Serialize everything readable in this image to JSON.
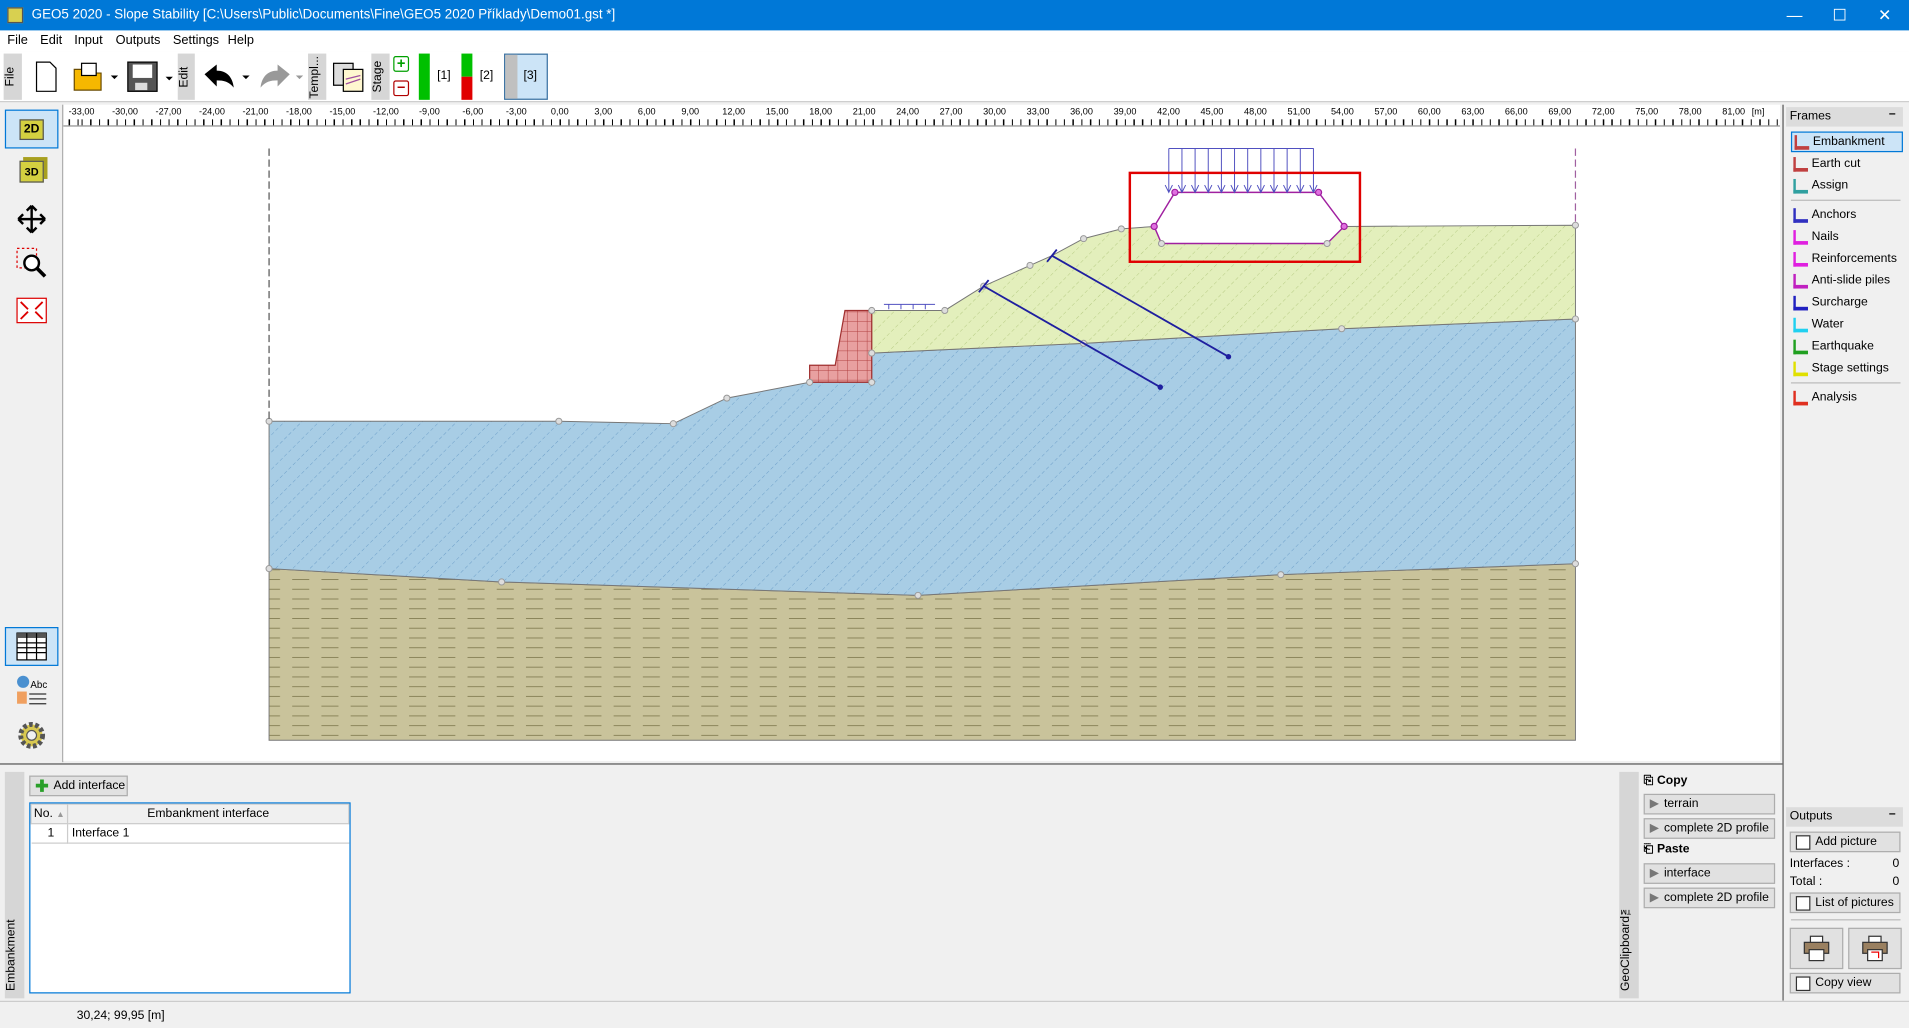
{
  "window": {
    "title": "GEO5 2020 - Slope Stability [C:\\Users\\Public\\Documents\\Fine\\GEO5 2020 Příklady\\Demo01.gst *]",
    "minimize": "—",
    "maximize": "☐",
    "close": "✕"
  },
  "menu": [
    "File",
    "Edit",
    "Input",
    "Outputs",
    "Settings",
    "Help"
  ],
  "toolbar": {
    "file_tab": "File",
    "edit_tab": "Edit",
    "templ_tab": "Templ...",
    "stage_tab": "Stage",
    "stages": [
      {
        "label": "[1]",
        "colors": [
          "#00c000"
        ]
      },
      {
        "label": "[2]",
        "colors": [
          "#00c000",
          "#e00000"
        ]
      },
      {
        "label": "[3]",
        "selected": true
      }
    ]
  },
  "ruler": {
    "labels": [
      "-33,00",
      "-30,00",
      "-27,00",
      "-24,00",
      "-21,00",
      "-18,00",
      "-15,00",
      "-12,00",
      "-9,00",
      "-6,00",
      "-3,00",
      "0,00",
      "3,00",
      "6,00",
      "9,00",
      "12,00",
      "15,00",
      "18,00",
      "21,00",
      "24,00",
      "27,00",
      "30,00",
      "33,00",
      "36,00",
      "39,00",
      "42,00",
      "45,00",
      "48,00",
      "51,00",
      "54,00",
      "57,00",
      "60,00",
      "63,00",
      "66,00",
      "69,00",
      "72,00",
      "75,00",
      "78,00",
      "81,00"
    ],
    "unit": "[m]"
  },
  "lefttools": {
    "view2d": "2D",
    "view3d": "3D"
  },
  "frames": {
    "header": "Frames",
    "collapse": "–",
    "items": [
      {
        "label": "Embankment",
        "icon": "embankment-icon",
        "selected": true
      },
      {
        "label": "Earth cut",
        "icon": "earth-cut-icon"
      },
      {
        "label": "Assign",
        "icon": "assign-icon"
      },
      {
        "label": "Anchors",
        "icon": "anchors-icon"
      },
      {
        "label": "Nails",
        "icon": "nails-icon"
      },
      {
        "label": "Reinforcements",
        "icon": "reinforcements-icon"
      },
      {
        "label": "Anti-slide piles",
        "icon": "anti-slide-piles-icon"
      },
      {
        "label": "Surcharge",
        "icon": "surcharge-icon"
      },
      {
        "label": "Water",
        "icon": "water-icon"
      },
      {
        "label": "Earthquake",
        "icon": "earthquake-icon"
      },
      {
        "label": "Stage settings",
        "icon": "stage-settings-icon"
      },
      {
        "label": "Analysis",
        "icon": "analysis-icon"
      }
    ]
  },
  "outputs": {
    "header": "Outputs",
    "collapse": "–",
    "add_picture": "Add picture",
    "interfaces_label": "Interfaces :",
    "interfaces_value": "0",
    "total_label": "Total :",
    "total_value": "0",
    "list_of_pictures": "List of pictures",
    "copy_view": "Copy view"
  },
  "embankment": {
    "tab": "Embankment",
    "add_interface": "Add interface",
    "columns": [
      "No.",
      "Embankment interface"
    ],
    "rows": [
      {
        "no": "1",
        "name": "Interface 1"
      }
    ]
  },
  "clipboard": {
    "tab": "GeoClipboard™",
    "copy": "Copy",
    "copy_items": [
      "terrain",
      "complete 2D profile"
    ],
    "paste": "Paste",
    "paste_items": [
      "interface",
      "complete 2D profile"
    ]
  },
  "status": {
    "coords": "30,24; 99,95 [m]"
  },
  "colors": {
    "accent": "#0078d7",
    "soil_upper": "#e3efbc",
    "soil_middle": "#a8cde5",
    "soil_bottom": "#c9c39b",
    "wall": "#e8a0a0",
    "anchor": "#1f1f9f",
    "embankment_outline": "#a020a0",
    "highlight": "#e00000"
  }
}
